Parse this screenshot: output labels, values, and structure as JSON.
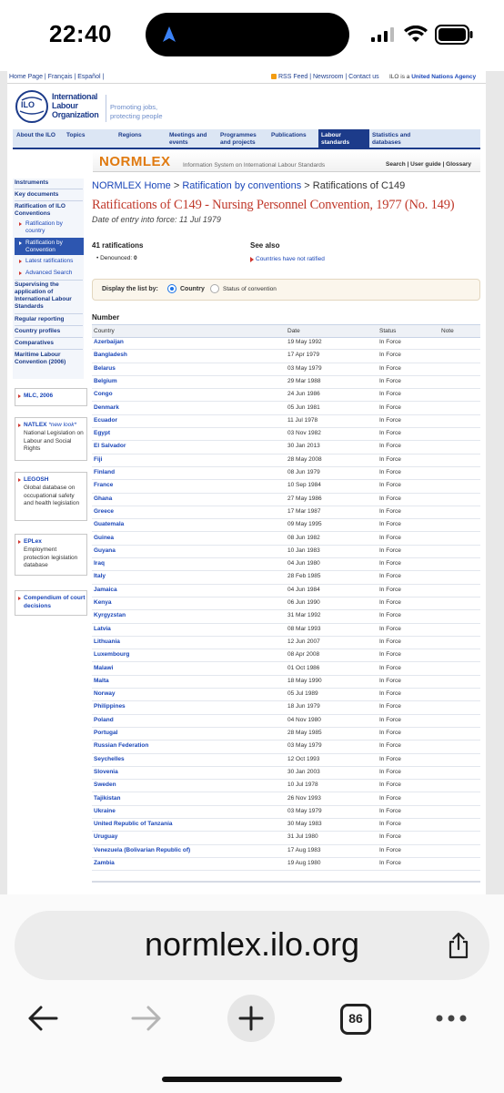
{
  "status_bar": {
    "time": "22:40"
  },
  "ilo_header": {
    "top_links": "Home Page | Français | Español |",
    "rss_links": "RSS Feed | Newsroom | Contact us",
    "agency_note_prefix": "ILO is a",
    "agency_note_link": "United Nations Agency",
    "org_name_line1": "International",
    "org_name_line2": "Labour",
    "org_name_line3": "Organization",
    "slogan_line1": "Promoting jobs,",
    "slogan_line2": "protecting people",
    "logo_text": "ILO"
  },
  "main_nav": [
    {
      "label": "About the ILO"
    },
    {
      "label": "Topics"
    },
    {
      "label": "Regions"
    },
    {
      "label": "Meetings and events"
    },
    {
      "label": "Programmes and projects"
    },
    {
      "label": "Publications"
    },
    {
      "label": "Labour standards"
    },
    {
      "label": "Statistics and databases"
    }
  ],
  "normlex": {
    "brand": "NORMLEX",
    "tagline": "Information System on International Labour Standards",
    "utility_links": [
      "Search",
      "User guide",
      "Glossary"
    ]
  },
  "breadcrumb": {
    "home": "NORMLEX Home",
    "sep1": ">",
    "conventions": "Ratification by conventions",
    "sep2": ">",
    "current": "Ratifications of C149"
  },
  "page_title": "Ratifications of C149 - Nursing Personnel Convention, 1977 (No. 149)",
  "entry_into_force": "Date of entry into force: 11 Jul 1979",
  "summary": {
    "ratifications": "41 ratifications",
    "denounced_label": "Denounced:",
    "denounced_value": "0",
    "see_also_heading": "See also",
    "see_also_link": "Countries have not ratified"
  },
  "display_list": {
    "label": "Display the list by:",
    "option_country": "Country",
    "option_status": "Status of convention"
  },
  "sidebar": {
    "items": [
      {
        "label": "Instruments"
      },
      {
        "label": "Key documents"
      },
      {
        "label": "Ratification of ILO Conventions"
      },
      {
        "label": "Ratification by country"
      },
      {
        "label": "Ratification by Convention"
      },
      {
        "label": "Latest ratifications"
      },
      {
        "label": "Advanced Search"
      },
      {
        "label": "Supervising the application of International Labour Standards"
      },
      {
        "label": "Regular reporting"
      },
      {
        "label": "Country profiles"
      },
      {
        "label": "Comparatives"
      },
      {
        "label": "Maritime Labour Convention (2006)"
      }
    ],
    "boxes": [
      {
        "title": "MLC, 2006",
        "desc": ""
      },
      {
        "title": "NATLEX",
        "title_note": "*new look*",
        "desc": "National Legislation on Labour and Social Rights"
      },
      {
        "title": "LEGOSH",
        "desc": "Global database on occupational safety and health legislation"
      },
      {
        "title": "EPLex",
        "desc": "Employment protection legislation database"
      },
      {
        "title": "Compendium of court decisions",
        "desc": ""
      }
    ]
  },
  "table": {
    "section_heading": "Number",
    "headers": {
      "country": "Country",
      "date": "Date",
      "status": "Status",
      "note": "Note"
    },
    "rows": [
      {
        "country": "Azerbaijan",
        "date": "19 May 1992",
        "status": "In Force"
      },
      {
        "country": "Bangladesh",
        "date": "17 Apr 1979",
        "status": "In Force"
      },
      {
        "country": "Belarus",
        "date": "03 May 1979",
        "status": "In Force"
      },
      {
        "country": "Belgium",
        "date": "29 Mar 1988",
        "status": "In Force"
      },
      {
        "country": "Congo",
        "date": "24 Jun 1986",
        "status": "In Force"
      },
      {
        "country": "Denmark",
        "date": "05 Jun 1981",
        "status": "In Force"
      },
      {
        "country": "Ecuador",
        "date": "11 Jul 1978",
        "status": "In Force"
      },
      {
        "country": "Egypt",
        "date": "03 Nov 1982",
        "status": "In Force"
      },
      {
        "country": "El Salvador",
        "date": "30 Jan 2013",
        "status": "In Force"
      },
      {
        "country": "Fiji",
        "date": "28 May 2008",
        "status": "In Force"
      },
      {
        "country": "Finland",
        "date": "08 Jun 1979",
        "status": "In Force"
      },
      {
        "country": "France",
        "date": "10 Sep 1984",
        "status": "In Force"
      },
      {
        "country": "Ghana",
        "date": "27 May 1986",
        "status": "In Force"
      },
      {
        "country": "Greece",
        "date": "17 Mar 1987",
        "status": "In Force"
      },
      {
        "country": "Guatemala",
        "date": "09 May 1995",
        "status": "In Force"
      },
      {
        "country": "Guinea",
        "date": "08 Jun 1982",
        "status": "In Force"
      },
      {
        "country": "Guyana",
        "date": "10 Jan 1983",
        "status": "In Force"
      },
      {
        "country": "Iraq",
        "date": "04 Jun 1980",
        "status": "In Force"
      },
      {
        "country": "Italy",
        "date": "28 Feb 1985",
        "status": "In Force"
      },
      {
        "country": "Jamaica",
        "date": "04 Jun 1984",
        "status": "In Force"
      },
      {
        "country": "Kenya",
        "date": "06 Jun 1990",
        "status": "In Force"
      },
      {
        "country": "Kyrgyzstan",
        "date": "31 Mar 1992",
        "status": "In Force"
      },
      {
        "country": "Latvia",
        "date": "08 Mar 1993",
        "status": "In Force"
      },
      {
        "country": "Lithuania",
        "date": "12 Jun 2007",
        "status": "In Force"
      },
      {
        "country": "Luxembourg",
        "date": "08 Apr 2008",
        "status": "In Force"
      },
      {
        "country": "Malawi",
        "date": "01 Oct 1986",
        "status": "In Force"
      },
      {
        "country": "Malta",
        "date": "18 May 1990",
        "status": "In Force"
      },
      {
        "country": "Norway",
        "date": "05 Jul 1989",
        "status": "In Force"
      },
      {
        "country": "Philippines",
        "date": "18 Jun 1979",
        "status": "In Force"
      },
      {
        "country": "Poland",
        "date": "04 Nov 1980",
        "status": "In Force"
      },
      {
        "country": "Portugal",
        "date": "28 May 1985",
        "status": "In Force"
      },
      {
        "country": "Russian Federation",
        "date": "03 May 1979",
        "status": "In Force"
      },
      {
        "country": "Seychelles",
        "date": "12 Oct 1993",
        "status": "In Force"
      },
      {
        "country": "Slovenia",
        "date": "30 Jan 2003",
        "status": "In Force"
      },
      {
        "country": "Sweden",
        "date": "10 Jul 1978",
        "status": "In Force"
      },
      {
        "country": "Tajikistan",
        "date": "26 Nov 1993",
        "status": "In Force"
      },
      {
        "country": "Ukraine",
        "date": "03 May 1979",
        "status": "In Force"
      },
      {
        "country": "United Republic of Tanzania",
        "date": "30 May 1983",
        "status": "In Force"
      },
      {
        "country": "Uruguay",
        "date": "31 Jul 1980",
        "status": "In Force"
      },
      {
        "country": "Venezuela (Bolivarian Republic of)",
        "date": "17 Aug 1983",
        "status": "In Force"
      },
      {
        "country": "Zambia",
        "date": "19 Aug 1980",
        "status": "In Force"
      }
    ]
  },
  "browser": {
    "url": "normlex.ilo.org",
    "tab_count": "86"
  },
  "colors": {
    "ilo_blue": "#1c3b8a",
    "normlex_orange": "#e07a10",
    "title_red": "#c0392b",
    "nav_active": "#1c3b8a",
    "nav_bg": "#dce6f4"
  }
}
